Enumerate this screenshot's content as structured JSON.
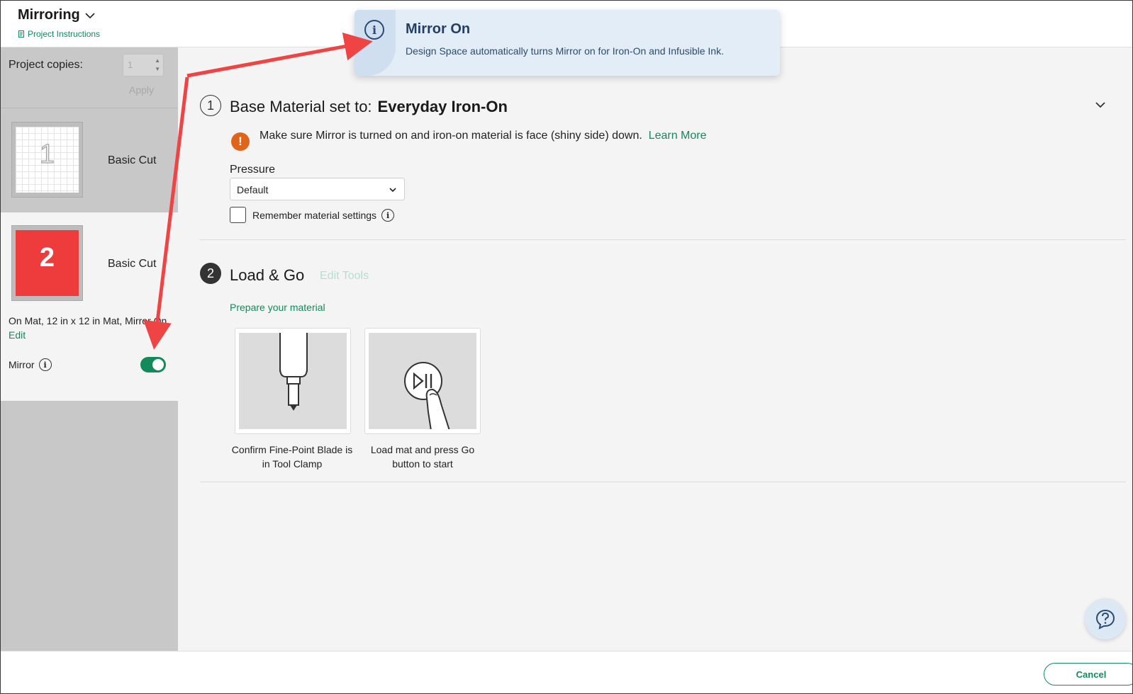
{
  "header": {
    "project_title": "Mirroring",
    "project_instructions": "Project Instructions"
  },
  "sidebar": {
    "copies_label": "Project copies:",
    "copies_value": "1",
    "apply_label": "Apply",
    "mats": [
      {
        "number": "1",
        "name": "Basic Cut"
      },
      {
        "number": "2",
        "name": "Basic Cut"
      }
    ],
    "selected_mat_info": "On Mat, 12 in x 12 in Mat, Mirror On",
    "edit_label": "Edit",
    "mirror_label": "Mirror",
    "mirror_on": true
  },
  "popover": {
    "title": "Mirror On",
    "body": "Design Space automatically turns Mirror on for Iron-On and Infusible Ink."
  },
  "step1": {
    "number": "1",
    "prefix": "Base Material set to:",
    "material": "Everyday Iron-On",
    "warning": "Make sure Mirror is turned on and iron-on material is face (shiny side) down.",
    "learn_more": "Learn More",
    "pressure_label": "Pressure",
    "pressure_value": "Default",
    "remember_label": "Remember material settings"
  },
  "step2": {
    "number": "2",
    "title": "Load & Go",
    "edit_tools": "Edit Tools",
    "prepare": "Prepare your material",
    "cards": [
      {
        "caption": "Confirm Fine-Point Blade is in Tool Clamp"
      },
      {
        "caption": "Load mat and press Go button to start"
      }
    ]
  },
  "footer": {
    "cancel_label": "Cancel"
  },
  "colors": {
    "accent": "#138a5b",
    "warning": "#e0651a",
    "mat_red": "#ee3b3b",
    "annotation_arrow": "#ee4444"
  }
}
